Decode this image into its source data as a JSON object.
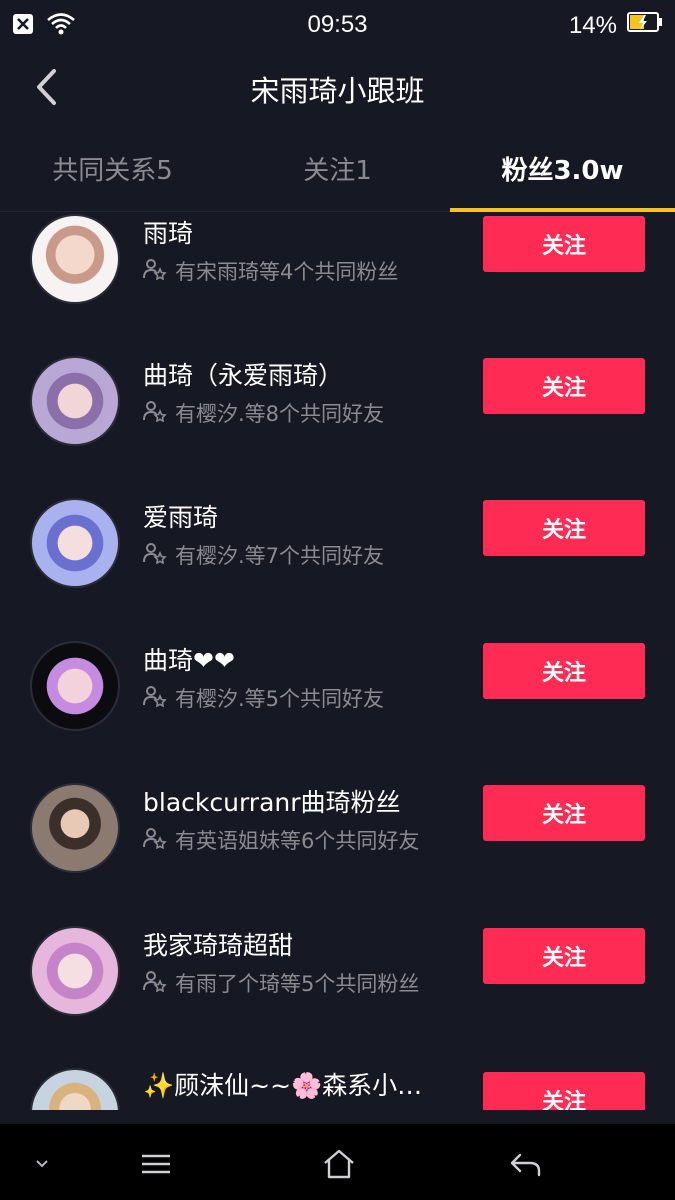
{
  "status_bar": {
    "time": "09:53",
    "battery_percent": "14%",
    "icons": [
      "close-notification-icon",
      "wifi-icon",
      "battery-charging-icon"
    ]
  },
  "header": {
    "title": "宋雨琦小跟班",
    "back_icon": "chevron-left-icon"
  },
  "tabs": [
    {
      "label": "共同关系5",
      "active": false
    },
    {
      "label": "关注1",
      "active": false
    },
    {
      "label": "粉丝3.0w",
      "active": true
    }
  ],
  "colors": {
    "background": "#161823",
    "accent_button": "#fe2c55",
    "tab_indicator": "#f5c423",
    "secondary_text": "#8a8b91"
  },
  "follow_label": "关注",
  "users": [
    {
      "name": "雨琦",
      "mutual": "有宋雨琦等4个共同粉丝"
    },
    {
      "name": "曲琦（永爱雨琦）",
      "mutual": "有樱汐.等8个共同好友"
    },
    {
      "name": "爱雨琦",
      "mutual": "有樱汐.等7个共同好友"
    },
    {
      "name": "曲琦❤❤",
      "mutual": "有樱汐.等5个共同好友"
    },
    {
      "name": "blackcurranr曲琦粉丝",
      "mutual": "有英语姐妹等6个共同好友"
    },
    {
      "name": "我家琦琦超甜",
      "mutual": "有雨了个琦等5个共同粉丝"
    },
    {
      "name": "✨顾沫仙~~🌸森系小…",
      "mutual": ""
    }
  ],
  "nav_bar": {
    "icons": [
      "chevron-down-icon",
      "menu-icon",
      "home-icon",
      "back-arrow-icon"
    ]
  }
}
